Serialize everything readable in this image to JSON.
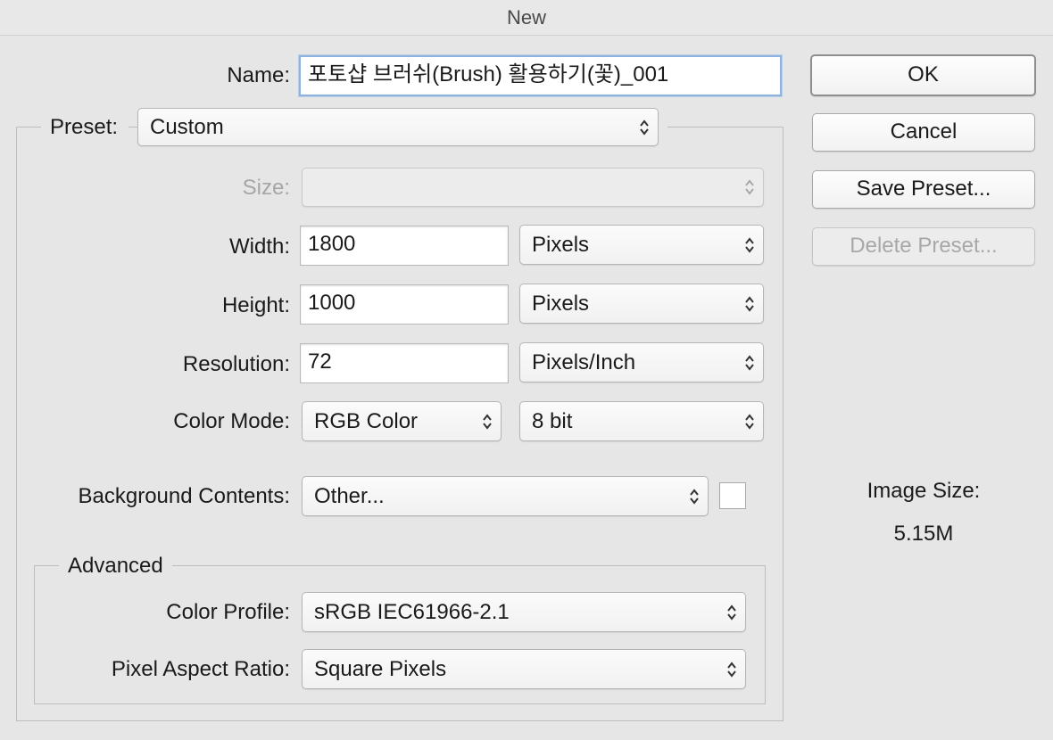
{
  "window": {
    "title": "New"
  },
  "name": {
    "label": "Name:",
    "value": "포토샵 브러쉬(Brush) 활용하기(꽃)_001"
  },
  "preset": {
    "label": "Preset:",
    "value": "Custom"
  },
  "size": {
    "label": "Size:",
    "value": ""
  },
  "width": {
    "label": "Width:",
    "value": "1800",
    "unit": "Pixels"
  },
  "height": {
    "label": "Height:",
    "value": "1000",
    "unit": "Pixels"
  },
  "resolution": {
    "label": "Resolution:",
    "value": "72",
    "unit": "Pixels/Inch"
  },
  "color_mode": {
    "label": "Color Mode:",
    "value": "RGB Color",
    "depth": "8 bit"
  },
  "background": {
    "label": "Background Contents:",
    "value": "Other...",
    "swatch_color": "#ffffff"
  },
  "advanced": {
    "title": "Advanced",
    "color_profile": {
      "label": "Color Profile:",
      "value": "sRGB IEC61966-2.1"
    },
    "pixel_aspect": {
      "label": "Pixel Aspect Ratio:",
      "value": "Square Pixels"
    }
  },
  "buttons": {
    "ok": "OK",
    "cancel": "Cancel",
    "save_preset": "Save Preset...",
    "delete_preset": "Delete Preset..."
  },
  "image_size": {
    "label": "Image Size:",
    "value": "5.15M"
  },
  "icons": {
    "select_arrows": "updown-chevron-icon"
  }
}
